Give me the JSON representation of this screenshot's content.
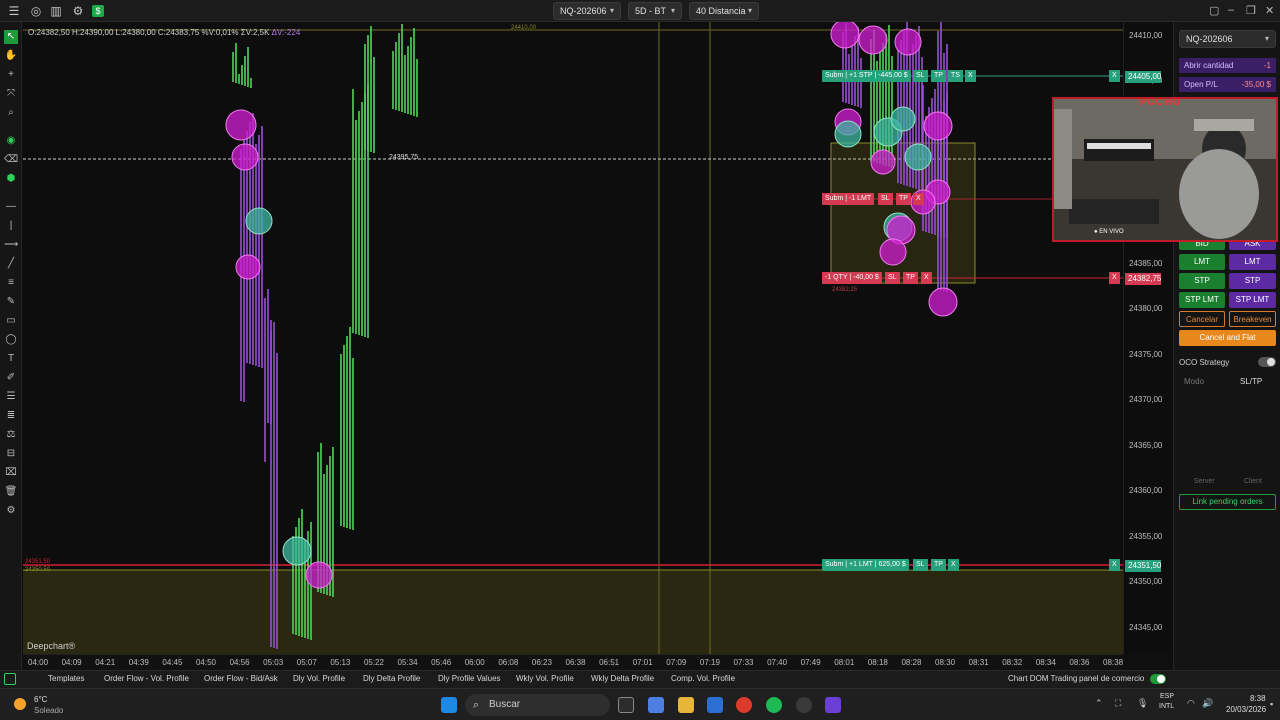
{
  "toolbar": {
    "symbol": "NQ-202606",
    "timeframe": "5D - BT",
    "bars": "40 Distancia"
  },
  "ohlc_line": {
    "text": "O:24382,50  H:24390,00  L:24380,00  C:24383,75  %V:0,01%  ΣV:2,5K",
    "delta": "ΔV:-224"
  },
  "price_ticks": [
    "24410,00",
    "24405,00",
    "24385,00",
    "24380,00",
    "24375,00",
    "24370,00",
    "24365,00",
    "24360,00",
    "24355,00",
    "24350,00",
    "24345,00"
  ],
  "time_ticks": [
    "04:00",
    "04:09",
    "04:21",
    "04:39",
    "04:45",
    "04:50",
    "04:56",
    "05:03",
    "05:07",
    "05:13",
    "05:22",
    "05:34",
    "05:46",
    "06:00",
    "06:08",
    "06:23",
    "06:38",
    "06:51",
    "07:01",
    "07:09",
    "07:19",
    "07:33",
    "07:40",
    "07:49",
    "08:01",
    "08:18",
    "08:28",
    "08:30",
    "08:31",
    "08:32",
    "08:34",
    "08:36",
    "08:38"
  ],
  "chart_labels": {
    "hline_label": "24395,75",
    "brand": "Deepchart®",
    "small_top": "24410,00",
    "small_mid": "24382,25",
    "left_red": "24351,50",
    "left_yellow": "24350,50"
  },
  "orders": {
    "stp_buy": {
      "label": "Subm | +1 STP | -445,00 $",
      "price": "24405,00"
    },
    "lmt_sell": {
      "label": "Subm | -1 LMT"
    },
    "position": {
      "label": "-1 QTY | -40,00 $",
      "price": "24382,75"
    },
    "lmt_buy": {
      "label": "Subm | +1 LMT | 625,00 $",
      "price": "24351,50"
    },
    "sl": "SL",
    "tp": "TP",
    "ts": "TS",
    "x": "X"
  },
  "right_panel": {
    "symbol": "NQ-202606",
    "qty_label": "Abrir cantidad",
    "qty_value": "-1",
    "pnl_label": "Open P/L",
    "pnl_value": "-35,00 $",
    "bid": "BID",
    "ask": "ASK",
    "lmt": "LMT",
    "stp": "STP",
    "stp_lmt": "STP LMT",
    "cancel": "Cancelar",
    "breakeven": "Breakeven",
    "cancel_flat": "Cancel and Flat",
    "oco": "OCO Strategy",
    "modo": "Modo",
    "sltp": "SL/TP",
    "server": "Server",
    "client": "Client",
    "link_pending": "Link pending orders"
  },
  "webcam": {
    "overlay_name": "PUCHO",
    "live": "● EN VIVO"
  },
  "bottom_tabs": [
    "Templates",
    "Order Flow - Vol. Profile",
    "Order Flow - Bid/Ask",
    "Dly Vol. Profile",
    "Dly Delta Profile",
    "Dly Profile Values",
    "Wkly Vol. Profile",
    "Wkly Delta Profile",
    "Comp. Vol. Profile"
  ],
  "bottom_right": {
    "chart_dom": "Chart DOM Trading",
    "panel": "panel de comercio"
  },
  "taskbar": {
    "temp": "6°C",
    "weather": "Soleado",
    "search": "Buscar",
    "lang1": "ESP",
    "lang2": "INTL",
    "time": "8:38",
    "date": "20/03/2026"
  },
  "colors": {
    "bull": "#4fd65a",
    "bear": "#9a4fd6",
    "bubble_magenta": "#d21ed2",
    "bubble_teal": "#3fb8a0",
    "order_green": "#26a17b",
    "order_red": "#d63a52"
  }
}
